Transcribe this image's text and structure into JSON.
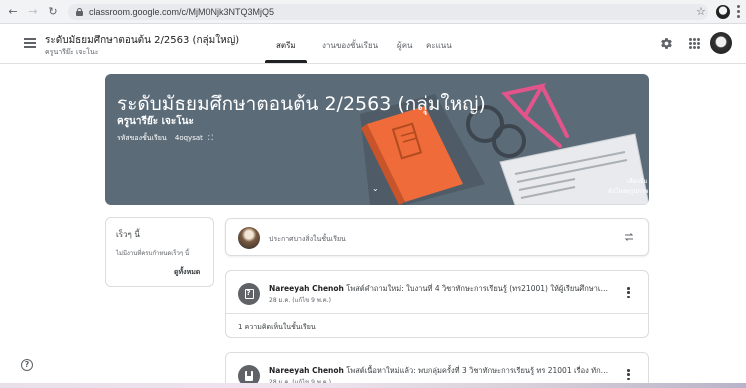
{
  "browser": {
    "url": "classroom.google.com/c/MjM0Njk3NTQ3MjQ5"
  },
  "header": {
    "class_title": "ระดับมัธยมศึกษาตอนต้น 2/2563 (กลุ่มใหญ่)",
    "class_subtitle": "ครูนารีย๊ะ เจะโนะ",
    "tabs": [
      {
        "label": "สตรีม",
        "active": true
      },
      {
        "label": "งานของชั้นเรียน",
        "active": false
      },
      {
        "label": "ผู้คน",
        "active": false
      },
      {
        "label": "คะแนน",
        "active": false
      }
    ]
  },
  "banner": {
    "title": "ระดับมัธยมศึกษาตอนต้น 2/2563 (กลุ่มใหญ่)",
    "teacher": "ครูนารีย๊ะ เจะโนะ",
    "class_code_label": "รหัสของชั้นเรียน",
    "class_code": "4oqysat",
    "select_theme": "เลือกธีม",
    "upload_photo": "อัปโหลดรูปภาพ",
    "color": "#5b6b78"
  },
  "upcoming": {
    "title": "เร็วๆ นี้",
    "empty_text": "ไม่มีงานที่ครบกำหนดเร็วๆ นี้",
    "view_all": "ดูทั้งหมด"
  },
  "announce": {
    "placeholder": "ประกาศบางสิ่งในชั้นเรียน"
  },
  "posts": [
    {
      "author": "Nareeyah Chenoh",
      "text": " โพสต์คำถามใหม่: ใบงานที่ 4 วิชาทักษะการเรียนรู้ (ทร21001) ให้ผู้เรียนศึกษาเรื่องเรือ...",
      "date": "28 ม.ค. (แก้ไข 9 พ.ค.)",
      "comments": "1 ความคิดเห็นในชั้นเรียน",
      "icon": "question-icon"
    },
    {
      "author": "Nareeyah Chenoh",
      "text": " โพสต์เนื้อหาใหม่แล้ว: พบกลุ่มครั้งที่ 3 วิชาทักษะการเรียนรู้ ทร 21001 เรื่อง ทักษะพื้นฐ...",
      "date": "28 ม.ค. (แก้ไข 9 พ.ค.)",
      "icon": "material-icon"
    }
  ]
}
